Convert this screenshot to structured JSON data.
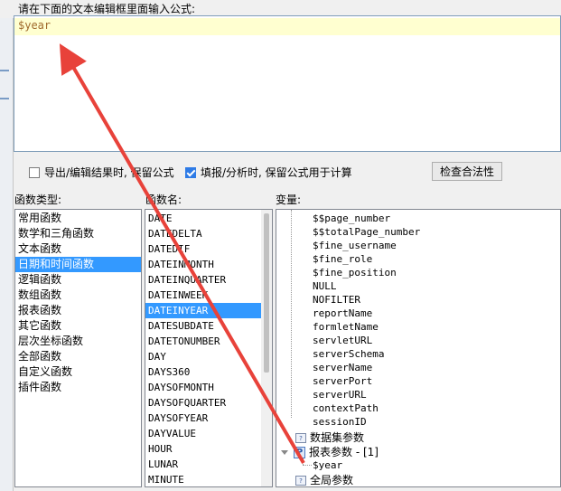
{
  "prompt": "请在下面的文本编辑框里面输入公式:",
  "editor": {
    "text": "$year"
  },
  "options": {
    "export_keep": {
      "label": "导出/编辑结果时, 保留公式",
      "checked": false
    },
    "fill_keep": {
      "label": "填报/分析时, 保留公式用于计算",
      "checked": true
    }
  },
  "check_button": "检查合法性",
  "labels": {
    "func_type": "函数类型:",
    "func_name": "函数名:",
    "variables": "变量:"
  },
  "func_types": [
    "常用函数",
    "数学和三角函数",
    "文本函数",
    "日期和时间函数",
    "逻辑函数",
    "数组函数",
    "报表函数",
    "其它函数",
    "层次坐标函数",
    "全部函数",
    "自定义函数",
    "插件函数"
  ],
  "func_types_selected": 3,
  "func_names": [
    "DATE",
    "DATEDELTA",
    "DATEDIF",
    "DATEINMONTH",
    "DATEINQUARTER",
    "DATEINWEEK",
    "DATEINYEAR",
    "DATESUBDATE",
    "DATETONUMBER",
    "DAY",
    "DAYS360",
    "DAYSOFMONTH",
    "DAYSOFQUARTER",
    "DAYSOFYEAR",
    "DAYVALUE",
    "HOUR",
    "LUNAR",
    "MINUTE"
  ],
  "func_names_selected": 6,
  "variables": [
    "$$page_number",
    "$$totalPage_number",
    "$fine_username",
    "$fine_role",
    "$fine_position",
    "NULL",
    "NOFILTER",
    "reportName",
    "formletName",
    "servletURL",
    "serverSchema",
    "serverName",
    "serverPort",
    "serverURL",
    "contextPath",
    "sessionID"
  ],
  "tree": {
    "dataset_params": "数据集参数",
    "report_params": "报表参数 - [1]",
    "report_param_item": "$year",
    "global_params": "全局参数"
  },
  "colors": {
    "selection": "#3399ff",
    "annotation_arrow": "#e8423a",
    "editor_highlight": "#ffffd0"
  }
}
